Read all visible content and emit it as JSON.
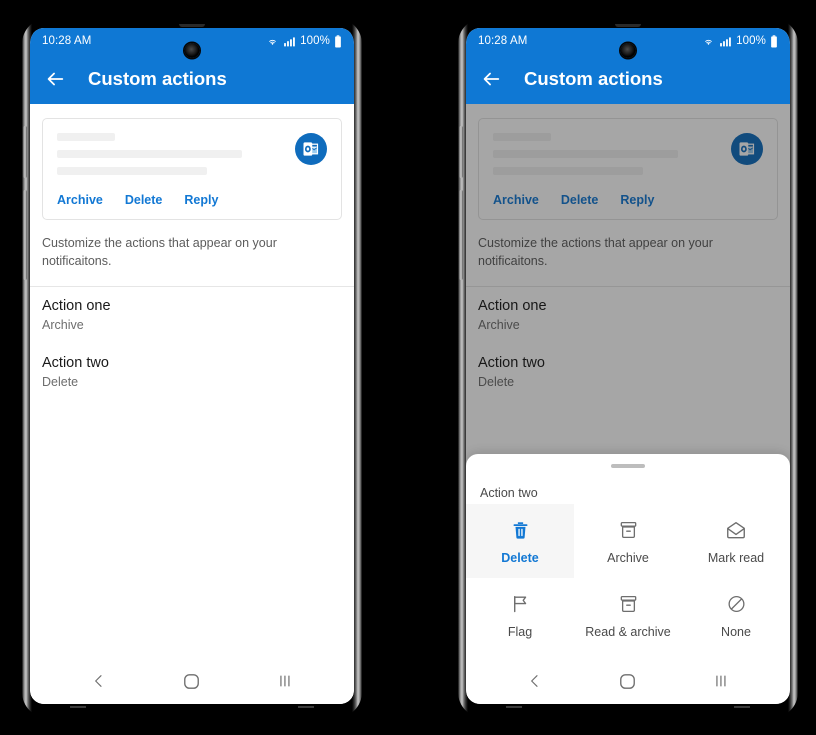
{
  "status_bar": {
    "time": "10:28 AM",
    "battery_text": "100%",
    "wifi_icon": "wifi-icon",
    "signal_icon": "signal-bars-icon",
    "battery_icon": "battery-icon"
  },
  "app_bar": {
    "title": "Custom actions",
    "back_icon": "back-arrow-icon"
  },
  "notification_card": {
    "app_icon": "outlook-icon",
    "actions": [
      "Archive",
      "Delete",
      "Reply"
    ]
  },
  "description": "Customize the actions that appear on your notificaitons.",
  "settings_list": [
    {
      "title": "Action one",
      "value": "Archive"
    },
    {
      "title": "Action two",
      "value": "Delete"
    }
  ],
  "nav_bar": {
    "back_icon": "nav-back-icon",
    "home_icon": "nav-home-icon",
    "recents_icon": "nav-recents-icon"
  },
  "bottom_sheet": {
    "grabber": "drag-handle",
    "title": "Action two",
    "options": [
      {
        "label": "Delete",
        "icon": "trash-icon",
        "selected": true
      },
      {
        "label": "Archive",
        "icon": "archive-box-icon",
        "selected": false
      },
      {
        "label": "Mark read",
        "icon": "open-envelope-icon",
        "selected": false
      },
      {
        "label": "Flag",
        "icon": "flag-icon",
        "selected": false
      },
      {
        "label": "Read & archive",
        "icon": "archive-box-icon",
        "selected": false
      },
      {
        "label": "None",
        "icon": "circle-slash-icon",
        "selected": false
      }
    ]
  },
  "colors": {
    "accent_blue": "#0f78d4",
    "link_blue": "#1278d4",
    "outlook_blue": "#0f6cbd",
    "placeholder_gray": "#f0f0f0",
    "scrim": "rgba(20,20,20,0.38)"
  }
}
